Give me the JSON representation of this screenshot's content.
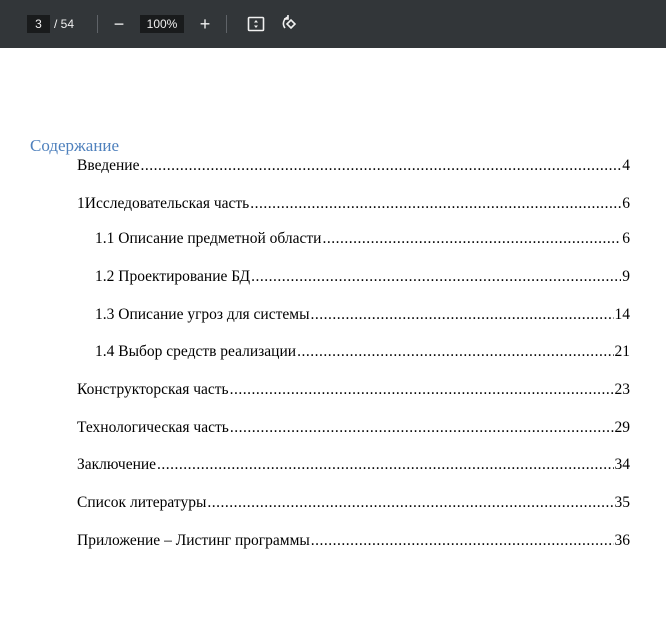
{
  "toolbar": {
    "current_page": "3",
    "total_pages": "/ 54",
    "zoom_out": "−",
    "zoom_level": "100%",
    "zoom_in": "+"
  },
  "toc": {
    "title": "Содержание",
    "entries": [
      {
        "label": "Введение",
        "page": "4",
        "level": 1
      },
      {
        "label": "1Исследовательская часть",
        "page": "6",
        "level": 1
      },
      {
        "label": "1.1 Описание предметной области",
        "page": "6",
        "level": 2
      },
      {
        "label": "1.2 Проектирование БД",
        "page": "9",
        "level": 2
      },
      {
        "label": "1.3 Описание угроз для системы",
        "page": "14",
        "level": 2
      },
      {
        "label": "1.4 Выбор средств реализации",
        "page": "21",
        "level": 2
      },
      {
        "label": "Конструкторская часть",
        "page": "23",
        "level": 1
      },
      {
        "label": "Технологическая часть",
        "page": "29",
        "level": 1
      },
      {
        "label": "Заключение",
        "page": "34",
        "level": 1
      },
      {
        "label": "Список литературы",
        "page": "35",
        "level": 1
      },
      {
        "label": "Приложение – Листинг программы",
        "page": "36",
        "level": 1
      }
    ]
  }
}
